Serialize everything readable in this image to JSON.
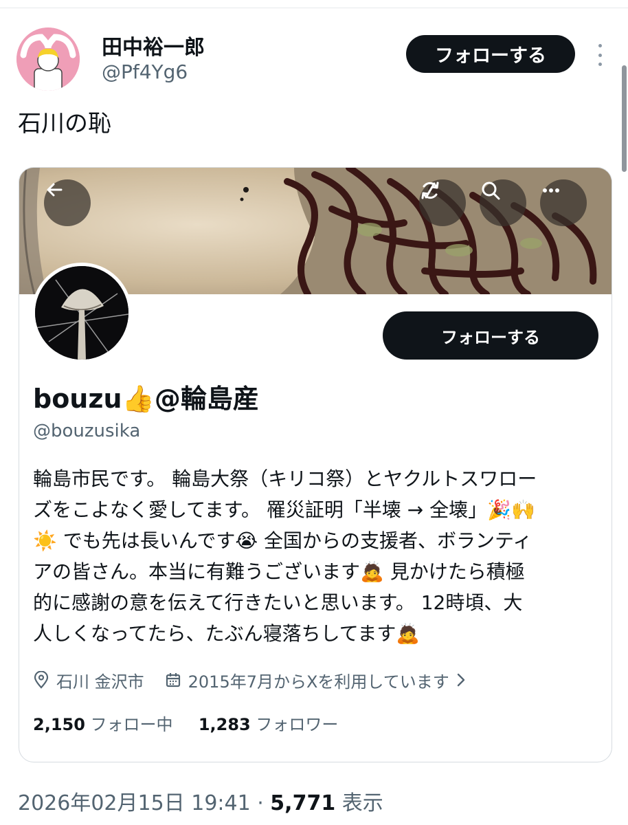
{
  "tweet": {
    "author_name": "田中裕一郎",
    "author_handle": "@Pf4Yg6",
    "follow_label": "フォローする",
    "text": "石川の恥",
    "timestamp": "2026年02月15日 19:41",
    "separator": " · ",
    "views_count": "5,771",
    "views_label": "表示"
  },
  "profile_card": {
    "follow_label": "フォローする",
    "display_name": "bouzu👍@輪島産",
    "handle": "@bouzusika",
    "bio_lines": [
      "輪島市民です。 輪島大祭（キリコ祭）とヤクルトスワロー",
      "ズをこよなく愛してます。 罹災証明「半壊 → 全壊」🎉🙌",
      "☀️ でも先は長いんです😭 全国からの支援者、ボランティ",
      "アの皆さん。本当に有難うございます🙇 見かけたら積極",
      "的に感謝の意を伝えて行きたいと思います。 12時頃、大",
      "人しくなってたら、たぶん寝落ちしてます🙇"
    ],
    "location": "石川 金沢市",
    "joined": "2015年7月からXを利用しています",
    "following_count": "2,150",
    "following_label": "フォロー中",
    "followers_count": "1,283",
    "followers_label": "フォロワー"
  },
  "icons": {
    "back": "arrow-left-icon",
    "sync": "sync-icon",
    "search": "search-icon",
    "more": "more-horizontal-icon",
    "location": "location-pin-icon",
    "calendar": "calendar-icon",
    "chevron": "chevron-right-icon"
  },
  "colors": {
    "primary_text": "#0f1419",
    "secondary_text": "#536471",
    "button_bg": "#0f1419",
    "author_avatar_bg": "#ef9eb7"
  }
}
